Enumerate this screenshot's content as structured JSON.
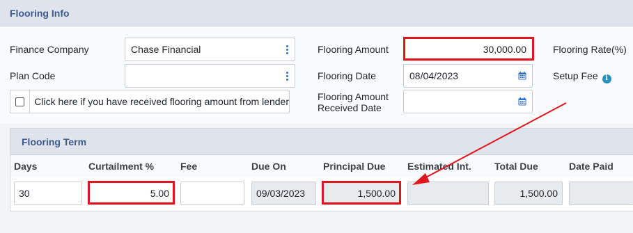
{
  "flooring_info": {
    "title": "Flooring Info",
    "finance_company": {
      "label": "Finance Company",
      "value": "Chase Financial"
    },
    "plan_code": {
      "label": "Plan Code",
      "value": ""
    },
    "received_checkbox": {
      "label": "Click here if you have received flooring amount from lender",
      "checked": false
    },
    "flooring_amount": {
      "label": "Flooring Amount",
      "value": "30,000.00"
    },
    "flooring_date": {
      "label": "Flooring Date",
      "value": "08/04/2023"
    },
    "received_date": {
      "label_line1": "Flooring Amount",
      "label_line2": "Received Date",
      "value": ""
    },
    "flooring_rate_label": "Flooring Rate(%)",
    "setup_fee_label": "Setup Fee",
    "setup_fee_info_glyph": "i"
  },
  "flooring_term": {
    "title": "Flooring Term",
    "columns": [
      "Days",
      "Curtailment %",
      "Fee",
      "Due On",
      "Principal Due",
      "Estimated Int.",
      "Total Due",
      "Date Paid"
    ],
    "row": {
      "days": "30",
      "curtailment": "5.00",
      "fee": "",
      "due_on": "09/03/2023",
      "principal_due": "1,500.00",
      "estimated_int": "",
      "total_due": "1,500.00",
      "date_paid": ""
    }
  },
  "annotations": {
    "highlight_color": "#e0141c"
  },
  "colors": {
    "header_bg": "#dfe3ec",
    "header_text": "#3c5a8a",
    "icon_blue": "#2f6ec7"
  }
}
